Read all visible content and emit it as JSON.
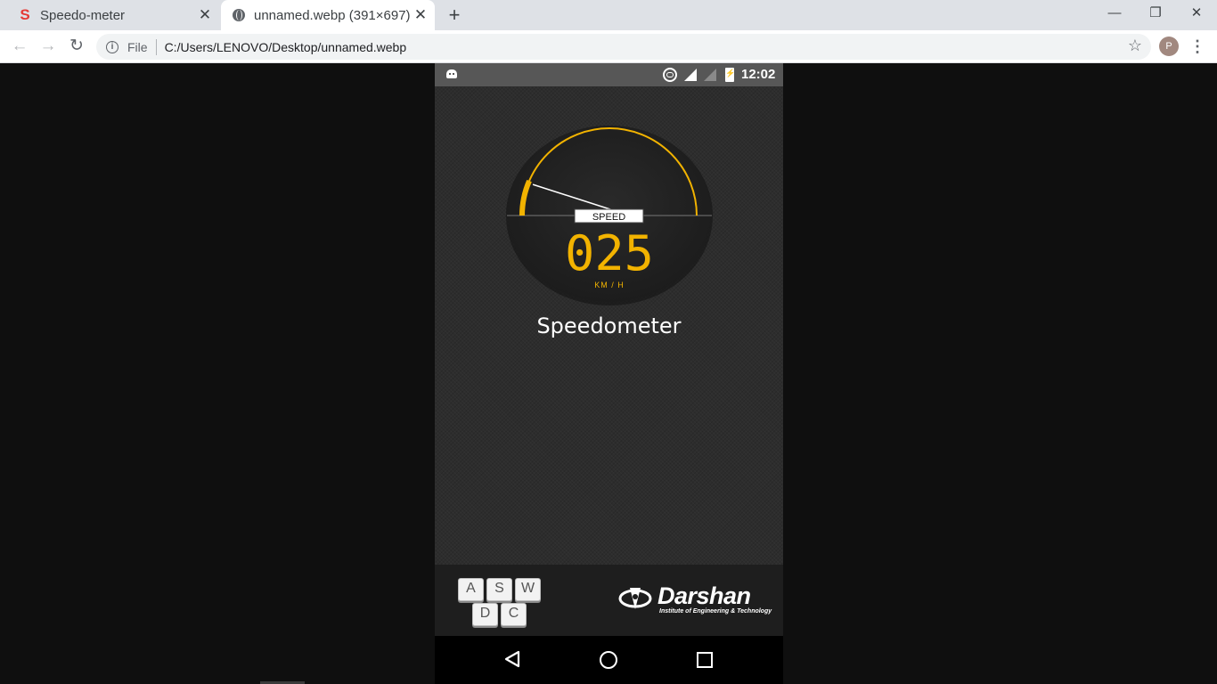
{
  "browser": {
    "tabs": [
      {
        "title": "Speedo-meter",
        "favicon": "s-logo-icon",
        "active": false
      },
      {
        "title": "unnamed.webp (391×697)",
        "favicon": "globe-icon",
        "active": true
      }
    ],
    "newtab_symbol": "+",
    "window_controls": {
      "minimize": "—",
      "maximize": "❐",
      "close": "✕"
    },
    "nav": {
      "back": "←",
      "forward": "→",
      "reload": "↻"
    },
    "address": {
      "scheme_label": "File",
      "url": "C:/Users/LENOVO/Desktop/unnamed.webp"
    },
    "profile_initial": "P",
    "menu_symbol": "⋮",
    "bookmark_symbol": "☆"
  },
  "phone": {
    "status_bar": {
      "time": "12:02"
    },
    "gauge": {
      "label": "SPEED",
      "value": "025",
      "unit": "KM / H",
      "needle_fraction": 0.13,
      "accent_color": "#f2b300"
    },
    "app_title": "Speedometer",
    "footer": {
      "keys": [
        "A",
        "S",
        "W",
        "D",
        "C"
      ],
      "brand_name": "Darshan",
      "brand_tagline": "Institute of Engineering & Technology"
    }
  }
}
